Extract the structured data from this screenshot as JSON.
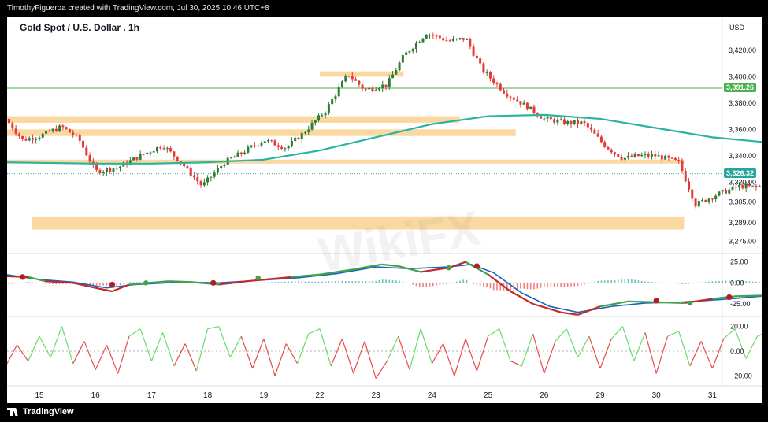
{
  "header": {
    "attribution": "TimothyFigueroa created with TradingView.com, Jul 30, 2025 10:46 UTC+8"
  },
  "title": "Gold Spot / U.S. Dollar . 1h",
  "currency": "USD",
  "footer": {
    "brand": "TradingView"
  },
  "watermark": "WikiFX",
  "colors": {
    "up": "#e53935",
    "down": "#2e7d32",
    "ma": "#26b5a5",
    "zone": "#fbd8a0",
    "hline": "#4caf50",
    "macd_line": "#c62828",
    "signal_line": "#1565c0",
    "osc_up": "#66dd66",
    "osc_down": "#e84a4a"
  },
  "chart_data": [
    {
      "type": "candlestick",
      "title": "Gold Spot / U.S. Dollar . 1h",
      "ylabel": "USD",
      "ylim": [
        3267,
        3445
      ],
      "y_ticks": [
        3420,
        3400,
        3380,
        3360,
        3340,
        3320,
        3305,
        3289,
        3275
      ],
      "x_ticks": [
        "15",
        "16",
        "17",
        "18",
        "19",
        "22",
        "23",
        "24",
        "25",
        "26",
        "29",
        "30",
        "31"
      ],
      "current_price": 3326.32,
      "horizontal_line": 3391.26,
      "horizontal_line_label": "3,391.26",
      "current_price_label": "3,326.32",
      "zones": [
        {
          "from_tick": "16",
          "to_tick": "31",
          "low": 3284,
          "high": 3294
        },
        {
          "from_tick": "15",
          "to_tick": "31",
          "low": 3334,
          "high": 3337
        },
        {
          "from_tick": "15",
          "to_tick": "26",
          "low": 3355,
          "high": 3360
        },
        {
          "from_tick": "15",
          "to_tick": "25",
          "low": 3365,
          "high": 3370
        },
        {
          "from_tick": "22",
          "to_tick": "24",
          "low": 3400,
          "high": 3404
        }
      ],
      "price_path": [
        [
          14.4,
          3368
        ],
        [
          14.7,
          3352
        ],
        [
          15.0,
          3355
        ],
        [
          15.4,
          3362
        ],
        [
          15.7,
          3353
        ],
        [
          16.0,
          3328
        ],
        [
          16.4,
          3331
        ],
        [
          16.8,
          3340
        ],
        [
          17.2,
          3348
        ],
        [
          17.5,
          3336
        ],
        [
          17.9,
          3317
        ],
        [
          18.3,
          3335
        ],
        [
          18.6,
          3342
        ],
        [
          19.0,
          3352
        ],
        [
          19.4,
          3346
        ],
        [
          19.7,
          3357
        ],
        [
          20.1,
          3374
        ],
        [
          20.5,
          3402
        ],
        [
          20.8,
          3390
        ],
        [
          21.2,
          3394
        ],
        [
          21.5,
          3416
        ],
        [
          21.9,
          3433
        ],
        [
          22.3,
          3427
        ],
        [
          22.6,
          3429
        ],
        [
          22.9,
          3405
        ],
        [
          23.3,
          3388
        ],
        [
          23.7,
          3377
        ],
        [
          24.0,
          3368
        ],
        [
          24.4,
          3365
        ],
        [
          24.7,
          3365
        ],
        [
          25.1,
          3347
        ],
        [
          25.4,
          3338
        ],
        [
          25.7,
          3340
        ],
        [
          26.0,
          3340
        ],
        [
          26.4,
          3335
        ],
        [
          26.7,
          3303
        ],
        [
          27.1,
          3311
        ],
        [
          27.5,
          3317
        ],
        [
          27.8,
          3316
        ],
        [
          28.2,
          3324
        ],
        [
          28.5,
          3328
        ],
        [
          28.7,
          3326.32
        ]
      ],
      "ma_path": [
        [
          14.4,
          3335
        ],
        [
          16.0,
          3334
        ],
        [
          17.0,
          3334
        ],
        [
          18.0,
          3335
        ],
        [
          19.0,
          3337
        ],
        [
          20.0,
          3344
        ],
        [
          21.0,
          3354
        ],
        [
          22.0,
          3364
        ],
        [
          23.0,
          3370
        ],
        [
          24.0,
          3371
        ],
        [
          25.0,
          3368
        ],
        [
          26.0,
          3361
        ],
        [
          27.0,
          3354
        ],
        [
          28.0,
          3350
        ],
        [
          28.7,
          3348
        ]
      ]
    },
    {
      "type": "line",
      "title": "",
      "ylim": [
        -40,
        35
      ],
      "y_ticks": [
        25,
        0,
        -25
      ],
      "series": [
        {
          "points": [
            [
              14.4,
              8
            ],
            [
              14.8,
              7
            ],
            [
              15.1,
              2
            ],
            [
              15.6,
              0
            ],
            [
              16.0,
              -6
            ],
            [
              16.3,
              -10
            ],
            [
              16.6,
              -2
            ],
            [
              17.3,
              2
            ],
            [
              17.7,
              1
            ],
            [
              18.2,
              -2
            ],
            [
              18.7,
              2
            ],
            [
              19.5,
              7
            ],
            [
              20.0,
              10
            ],
            [
              20.6,
              16
            ],
            [
              21.1,
              22
            ],
            [
              21.4,
              20
            ],
            [
              21.8,
              13
            ],
            [
              22.3,
              18
            ],
            [
              22.6,
              25
            ],
            [
              23.0,
              10
            ],
            [
              23.4,
              -10
            ],
            [
              23.8,
              -25
            ],
            [
              24.3,
              -35
            ],
            [
              24.6,
              -38
            ],
            [
              25.0,
              -28
            ],
            [
              25.5,
              -22
            ],
            [
              26.0,
              -23
            ],
            [
              26.5,
              -24
            ],
            [
              27.0,
              -19
            ],
            [
              27.4,
              -16
            ],
            [
              27.9,
              -15
            ],
            [
              28.3,
              -10
            ],
            [
              28.7,
              0
            ]
          ]
        },
        {
          "points": [
            [
              14.4,
              10
            ],
            [
              15.0,
              4
            ],
            [
              15.6,
              1
            ],
            [
              16.2,
              -6
            ],
            [
              16.7,
              -2
            ],
            [
              17.5,
              1
            ],
            [
              18.2,
              0
            ],
            [
              18.9,
              3
            ],
            [
              19.6,
              6
            ],
            [
              20.3,
              11
            ],
            [
              21.0,
              19
            ],
            [
              21.6,
              17
            ],
            [
              22.3,
              19
            ],
            [
              22.7,
              22
            ],
            [
              23.1,
              12
            ],
            [
              23.6,
              -12
            ],
            [
              24.1,
              -28
            ],
            [
              24.6,
              -35
            ],
            [
              25.2,
              -28
            ],
            [
              25.8,
              -24
            ],
            [
              26.4,
              -23
            ],
            [
              26.9,
              -21
            ],
            [
              27.5,
              -18
            ],
            [
              28.0,
              -15
            ],
            [
              28.4,
              -8
            ],
            [
              28.7,
              -1
            ]
          ]
        }
      ],
      "histogram_range": [
        14.4,
        28.7
      ],
      "cross_markers_up": [
        [
          16.9,
          0
        ],
        [
          18.9,
          6
        ],
        [
          22.3,
          18
        ],
        [
          26.6,
          -24
        ],
        [
          28.2,
          -13
        ]
      ],
      "cross_markers_down": [
        [
          14.7,
          7
        ],
        [
          16.3,
          -2
        ],
        [
          18.1,
          0
        ],
        [
          22.8,
          20
        ],
        [
          26.0,
          -21
        ],
        [
          27.3,
          -17
        ]
      ]
    },
    {
      "type": "line",
      "title": "",
      "ylim": [
        -28,
        28
      ],
      "y_ticks": [
        20,
        0,
        -20
      ],
      "series": [
        {
          "points": [
            [
              14.4,
              -12
            ],
            [
              14.6,
              5
            ],
            [
              14.8,
              -8
            ],
            [
              15.0,
              12
            ],
            [
              15.2,
              -5
            ],
            [
              15.4,
              20
            ],
            [
              15.6,
              -10
            ],
            [
              15.8,
              8
            ],
            [
              16.0,
              -15
            ],
            [
              16.2,
              5
            ],
            [
              16.4,
              -18
            ],
            [
              16.6,
              12
            ],
            [
              16.8,
              18
            ],
            [
              17.0,
              -8
            ],
            [
              17.2,
              15
            ],
            [
              17.4,
              -12
            ],
            [
              17.6,
              6
            ],
            [
              17.8,
              -16
            ],
            [
              18.0,
              18
            ],
            [
              18.2,
              20
            ],
            [
              18.4,
              -5
            ],
            [
              18.6,
              12
            ],
            [
              18.8,
              -14
            ],
            [
              19.0,
              10
            ],
            [
              19.2,
              -20
            ],
            [
              19.4,
              6
            ],
            [
              19.6,
              -10
            ],
            [
              19.8,
              14
            ],
            [
              20.0,
              18
            ],
            [
              20.2,
              -12
            ],
            [
              20.4,
              10
            ],
            [
              20.6,
              -18
            ],
            [
              20.8,
              8
            ],
            [
              21.0,
              -22
            ],
            [
              21.2,
              -8
            ],
            [
              21.4,
              12
            ],
            [
              21.6,
              -15
            ],
            [
              21.8,
              18
            ],
            [
              22.0,
              -10
            ],
            [
              22.2,
              6
            ],
            [
              22.4,
              -20
            ],
            [
              22.6,
              10
            ],
            [
              22.8,
              -16
            ],
            [
              23.0,
              12
            ],
            [
              23.2,
              18
            ],
            [
              23.4,
              -8
            ],
            [
              23.6,
              -12
            ],
            [
              23.8,
              14
            ],
            [
              24.0,
              -18
            ],
            [
              24.2,
              8
            ],
            [
              24.4,
              18
            ],
            [
              24.6,
              -5
            ],
            [
              24.8,
              12
            ],
            [
              25.0,
              -14
            ],
            [
              25.2,
              10
            ],
            [
              25.4,
              20
            ],
            [
              25.6,
              -8
            ],
            [
              25.8,
              15
            ],
            [
              26.0,
              -18
            ],
            [
              26.2,
              12
            ],
            [
              26.4,
              16
            ],
            [
              26.6,
              -12
            ],
            [
              26.8,
              8
            ],
            [
              27.0,
              -14
            ],
            [
              27.2,
              10
            ],
            [
              27.4,
              18
            ],
            [
              27.6,
              -6
            ],
            [
              27.8,
              12
            ],
            [
              28.0,
              16
            ],
            [
              28.2,
              -8
            ],
            [
              28.4,
              10
            ],
            [
              28.6,
              -10
            ],
            [
              28.7,
              0
            ]
          ]
        }
      ]
    }
  ]
}
